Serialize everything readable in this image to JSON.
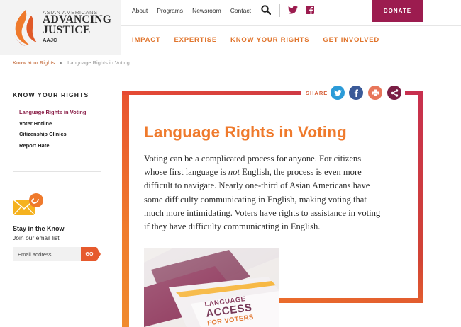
{
  "brand": {
    "top_line": "ASIAN AMERICANS",
    "name_line1": "ADVANCING",
    "name_line2": "JUSTICE",
    "sub": "AAJC"
  },
  "topnav": [
    "About",
    "Programs",
    "Newsroom",
    "Contact"
  ],
  "donate_label": "DONATE",
  "mainnav": [
    "IMPACT",
    "EXPERTISE",
    "KNOW YOUR RIGHTS",
    "GET INVOLVED"
  ],
  "breadcrumb": {
    "parent": "Know Your Rights",
    "separator": "▸",
    "current": "Language Rights in Voting"
  },
  "sidebar": {
    "title": "KNOW YOUR RIGHTS",
    "items": [
      {
        "label": "Language Rights in Voting",
        "active": true
      },
      {
        "label": "Voter Hotline",
        "active": false
      },
      {
        "label": "Citizenship Clinics",
        "active": false
      },
      {
        "label": "Report Hate",
        "active": false
      }
    ],
    "newsletter": {
      "title": "Stay in the Know",
      "subtitle": "Join our email list",
      "placeholder": "Email address",
      "button": "GO"
    }
  },
  "share": {
    "label": "SHARE",
    "icons": [
      "twitter-icon",
      "facebook-icon",
      "print-icon",
      "share-icon"
    ]
  },
  "article": {
    "title": "Language Rights in Voting",
    "lede_part1": "Voting can be a complicated process for anyone. For citizens whose first language is ",
    "lede_emph": "not",
    "lede_part2": " English, the process is even more difficult to navigate. Nearly one-third of Asian Americans have some difficulty communicating in English, making voting that much more intimidating. Voters have rights to assistance in voting if they have difficulty communicating in English."
  },
  "photo_text": {
    "line1": "LANGUAGE",
    "line2": "ACCESS",
    "line3": "FOR VOTERS"
  },
  "colors": {
    "orange": "#ef7a2c",
    "maroon": "#9c1c4f",
    "crimson": "#c7304f",
    "twitter": "#2b9bd8",
    "facebook": "#3b5a98",
    "print": "#e8765a",
    "share": "#7a1e45"
  }
}
